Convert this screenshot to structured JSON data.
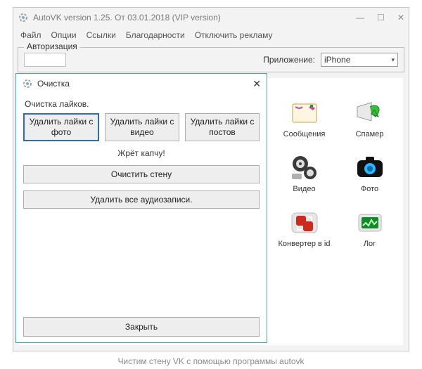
{
  "window": {
    "title": "AutoVK version 1.25. От 03.01.2018 (VIP version)"
  },
  "menu": {
    "file": "Файл",
    "options": "Опции",
    "links": "Ссылки",
    "thanks": "Благодарности",
    "disable_ads": "Отключить рекламу"
  },
  "auth": {
    "legend": "Авторизация",
    "app_label": "Приложение:",
    "app_selected": "iPhone"
  },
  "grid": {
    "messages": "Сообщения",
    "spammer": "Спамер",
    "video": "Видео",
    "photo": "Фото",
    "converter": "Конвертер в id",
    "log": "Лог"
  },
  "modal": {
    "title": "Очистка",
    "subtitle": "Очистка лайков.",
    "btn_photo": "Удалить лайки с фото",
    "btn_video": "Удалить лайки с видео",
    "btn_posts": "Удалить лайки с постов",
    "captcha_note": "Жрёт капчу!",
    "clear_wall": "Очистить стену",
    "delete_audio": "Удалить все аудиозаписи.",
    "close": "Закрыть"
  },
  "caption": "Чистим стену VK с помощью программы autovk"
}
